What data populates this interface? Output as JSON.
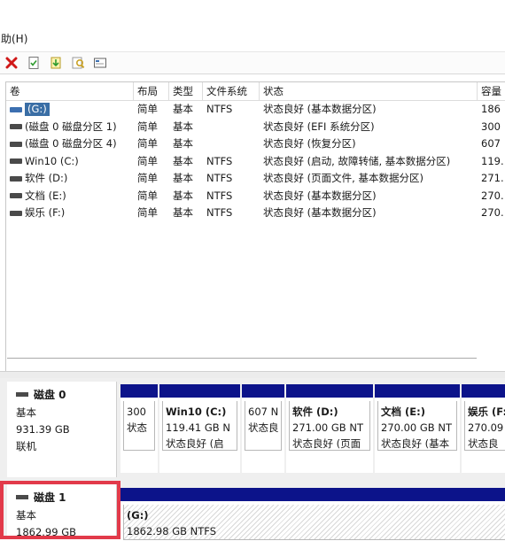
{
  "menu": {
    "help": "助(H)"
  },
  "toolbar": [
    "delete-icon",
    "properties-icon",
    "refresh-icon",
    "help-search-icon",
    "view-icon"
  ],
  "volume_table": {
    "headers": [
      "卷",
      "布局",
      "类型",
      "文件系统",
      "状态",
      "容量"
    ],
    "rows": [
      {
        "name": "(G:)",
        "layout": "简单",
        "type": "基本",
        "fs": "NTFS",
        "status": "状态良好 (基本数据分区)",
        "capacity": "186",
        "selected": true
      },
      {
        "name": "(磁盘 0 磁盘分区 1)",
        "layout": "简单",
        "type": "基本",
        "fs": "",
        "status": "状态良好 (EFI 系统分区)",
        "capacity": "300"
      },
      {
        "name": "(磁盘 0 磁盘分区 4)",
        "layout": "简单",
        "type": "基本",
        "fs": "",
        "status": "状态良好 (恢复分区)",
        "capacity": "607"
      },
      {
        "name": "Win10 (C:)",
        "layout": "简单",
        "type": "基本",
        "fs": "NTFS",
        "status": "状态良好 (启动, 故障转储, 基本数据分区)",
        "capacity": "119."
      },
      {
        "name": "软件 (D:)",
        "layout": "简单",
        "type": "基本",
        "fs": "NTFS",
        "status": "状态良好 (页面文件, 基本数据分区)",
        "capacity": "271."
      },
      {
        "name": "文档 (E:)",
        "layout": "简单",
        "type": "基本",
        "fs": "NTFS",
        "status": "状态良好 (基本数据分区)",
        "capacity": "270."
      },
      {
        "name": "娱乐 (F:)",
        "layout": "简单",
        "type": "基本",
        "fs": "NTFS",
        "status": "状态良好 (基本数据分区)",
        "capacity": "270."
      }
    ]
  },
  "disk0": {
    "name": "磁盘 0",
    "type": "基本",
    "size": "931.39 GB",
    "status": "联机",
    "partitions": [
      {
        "line1": "",
        "line2": "300",
        "line3": "状态"
      },
      {
        "line1": "Win10 (C:)",
        "line2": "119.41 GB N",
        "line3": "状态良好 (启"
      },
      {
        "line1": "",
        "line2": "607 N",
        "line3": "状态良"
      },
      {
        "line1": "软件 (D:)",
        "line2": "271.00 GB NT",
        "line3": "状态良好 (页面"
      },
      {
        "line1": "文档 (E:)",
        "line2": "270.00 GB NT",
        "line3": "状态良好 (基本"
      },
      {
        "line1": "娱乐 (F:)",
        "line2": "270.09",
        "line3": "状态良"
      }
    ]
  },
  "disk1": {
    "name": "磁盘 1",
    "type": "基本",
    "size": "1862.99 GB",
    "partition": {
      "line1": "(G:)",
      "line2": "1862.98 GB NTFS"
    }
  }
}
